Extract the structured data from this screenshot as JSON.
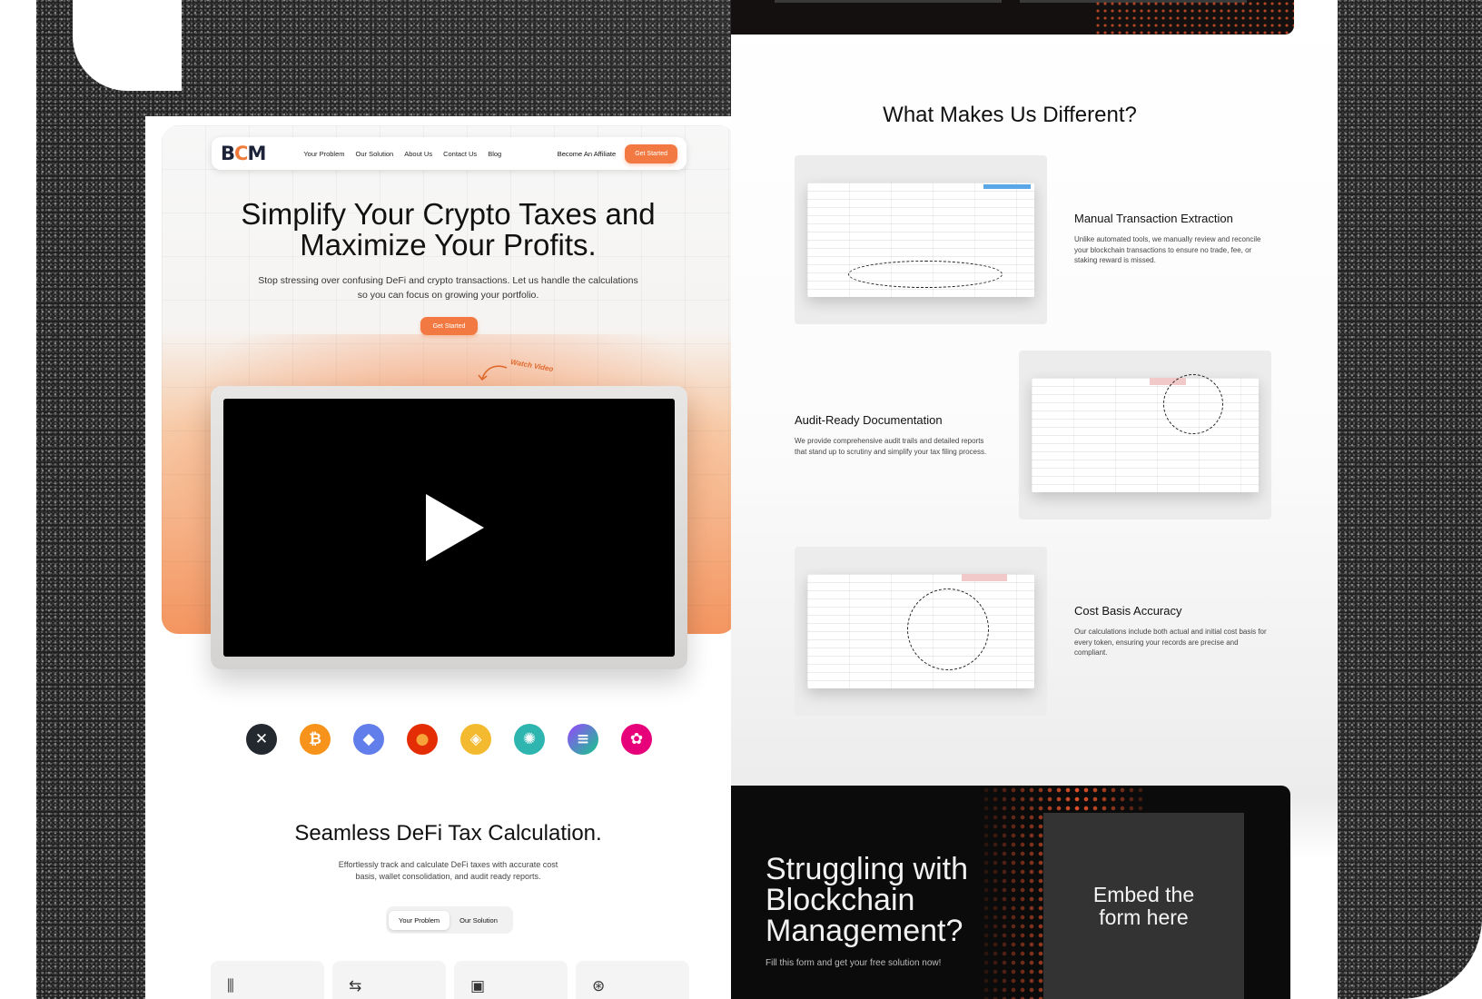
{
  "left": {
    "nav": {
      "logo_b": "B",
      "logo_c": "C",
      "logo_m": "M",
      "links": [
        "Your Problem",
        "Our Solution",
        "About Us",
        "Contact Us",
        "Blog"
      ],
      "affiliate": "Become An Affiliate",
      "cta": "Get Started"
    },
    "hero": {
      "title_line1": "Simplify Your Crypto Taxes and",
      "title_line2": "Maximize Your Profits.",
      "subtitle": "Stop stressing over confusing DeFi and crypto transactions. Let us handle the calculations so you can focus on growing your portfolio.",
      "cta": "Get Started",
      "watch_video": "Watch Video"
    },
    "coins": [
      {
        "icon": "xrp-icon",
        "glyph": "✕",
        "color": "#23292f"
      },
      {
        "icon": "bitcoin-icon",
        "glyph": "₿",
        "color": "#f7931a"
      },
      {
        "icon": "ethereum-icon",
        "glyph": "◆",
        "color": "#627eea"
      },
      {
        "icon": "shiba-inu-icon",
        "glyph": "●",
        "color": "#e42d04"
      },
      {
        "icon": "binance-icon",
        "glyph": "◈",
        "color": "#f3ba2f"
      },
      {
        "icon": "cardano-icon",
        "glyph": "✺",
        "color": "#2fb5b0"
      },
      {
        "icon": "solana-icon",
        "glyph": "≡",
        "color": "#9945ff"
      },
      {
        "icon": "polkadot-icon",
        "glyph": "✿",
        "color": "#e6007a"
      }
    ],
    "section": {
      "title": "Seamless DeFi Tax Calculation.",
      "subtitle": "Effortlessly track and calculate DeFi taxes with accurate cost basis, wallet consolidation, and audit ready reports.",
      "toggle": [
        "Your Problem",
        "Our Solution"
      ]
    },
    "cards": [
      {
        "icon": "chart-bars-icon",
        "glyph": "⫼"
      },
      {
        "icon": "exchange-icon",
        "glyph": "⇆"
      },
      {
        "icon": "wallet-icon",
        "glyph": "▣"
      },
      {
        "icon": "coin-search-icon",
        "glyph": "⊛"
      }
    ]
  },
  "right": {
    "title": "What Makes Us Different?",
    "features": [
      {
        "name": "Manual Transaction Extraction",
        "desc": "Unlike automated tools, we manually review and reconcile your blockchain transactions to ensure no trade, fee, or staking reward is missed."
      },
      {
        "name": "Audit-Ready Documentation",
        "desc": "We provide comprehensive audit trails and detailed reports that stand up to scrutiny and simplify your tax filing process."
      },
      {
        "name": "Cost Basis Accuracy",
        "desc": "Our calculations include both actual and initial cost basis for every token, ensuring your records are precise and compliant."
      }
    ],
    "cta": {
      "title_line1": "Struggling with",
      "title_line2": "Blockchain",
      "title_line3": "Management?",
      "subtitle": "Fill this form and get your free solution now!",
      "form_line1": "Embed the",
      "form_line2": "form here"
    }
  },
  "colors": {
    "accent": "#f27a42",
    "dark": "#0b0b0b"
  }
}
